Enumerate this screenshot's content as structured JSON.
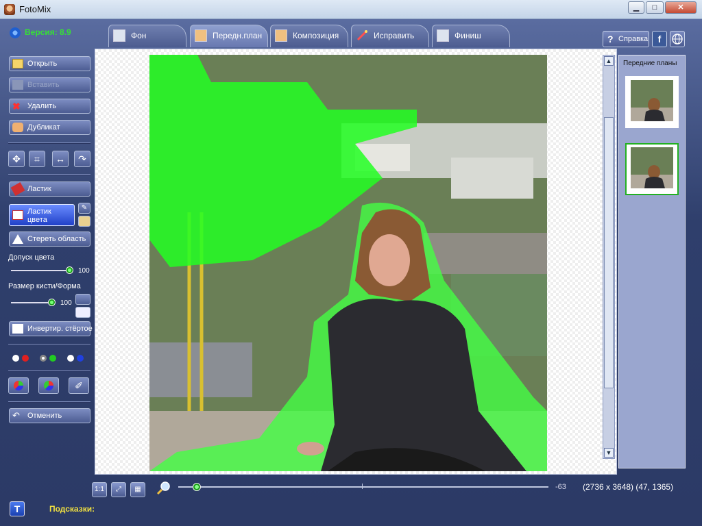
{
  "window": {
    "title": "FotoMix",
    "controls": [
      "▁",
      "□",
      "✕"
    ]
  },
  "app": {
    "version_label": "Версия: 8.9"
  },
  "tabs": [
    {
      "label": "Фон",
      "active": false
    },
    {
      "label": "Передн.план",
      "active": true
    },
    {
      "label": "Композиция",
      "active": false
    },
    {
      "label": "Исправить",
      "active": false
    },
    {
      "label": "Финиш",
      "active": false
    }
  ],
  "header_buttons": {
    "help_label": "Справка",
    "facebook_icon": "f",
    "web_icon": "globe"
  },
  "sidebar": {
    "open_label": "Открыть",
    "paste_label": "Вставить",
    "delete_label": "Удалить",
    "duplicate_label": "Дубликат",
    "eraser_label": "Ластик",
    "color_eraser_label_line1": "Ластик",
    "color_eraser_label_line2": "цвета",
    "erase_area_label": "Стереть область",
    "color_tolerance_label": "Допуск цвета",
    "color_tolerance_value": "100",
    "brush_size_label": "Размер кисти/Форма",
    "brush_size_value": "100",
    "invert_label": "Инвертир. стёртое",
    "undo_label": "Отменить"
  },
  "foreground_panel": {
    "title": "Передние планы"
  },
  "bottom": {
    "zoom_100_label": "1:1",
    "zoom_value": "-63",
    "coords": "(2736 x 3648) (47, 1365)",
    "hints_label": "Подсказки:",
    "text_button": "T"
  },
  "colors": {
    "mask_green": "#22ff22",
    "version_green": "#36e036",
    "hints_yellow": "#f0e040",
    "accent_blue": "#3a4a78"
  }
}
